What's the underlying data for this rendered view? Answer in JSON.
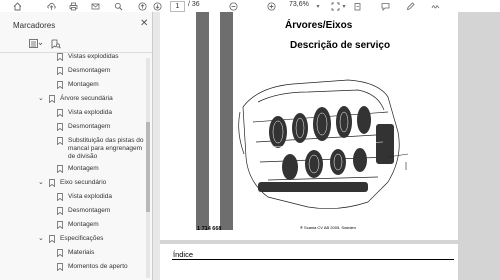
{
  "toolbar": {
    "current_page": "1",
    "total_pages": "/ 36",
    "zoom": "73,6%",
    "icons": [
      "home-icon",
      "upload-icon",
      "print-icon",
      "mail-icon",
      "search-icon",
      "up-arrow-icon",
      "down-arrow-icon",
      "zoom-out-icon",
      "zoom-in-icon",
      "chevron-down-icon",
      "cursor-icon",
      "hand-icon",
      "fit-page-icon",
      "chevron-down-icon",
      "rotate-icon",
      "comment-icon",
      "pen-icon",
      "sign-icon"
    ]
  },
  "sidebar": {
    "title": "Marcadores",
    "items": [
      {
        "label": "Vistas explodidas",
        "level": 2
      },
      {
        "label": "Desmontagem",
        "level": 2
      },
      {
        "label": "Montagem",
        "level": 2
      },
      {
        "label": "Árvore secundária",
        "level": 1,
        "expanded": true
      },
      {
        "label": "Vista explodida",
        "level": 2
      },
      {
        "label": "Desmontagem",
        "level": 2
      },
      {
        "label": "Substituição das pistas do mancal para engrenagem de divisão",
        "level": 2
      },
      {
        "label": "Montagem",
        "level": 2
      },
      {
        "label": "Eixo secundário",
        "level": 1,
        "expanded": true
      },
      {
        "label": "Vista explodida",
        "level": 2
      },
      {
        "label": "Desmontagem",
        "level": 2
      },
      {
        "label": "Montagem",
        "level": 2
      },
      {
        "label": "Especificações",
        "level": 1,
        "expanded": true
      },
      {
        "label": "Materiais",
        "level": 2
      },
      {
        "label": "Momentos de aperto",
        "level": 2
      }
    ]
  },
  "document": {
    "title": "Árvores/Eixos",
    "subtitle": "Descrição de serviço",
    "part_number": "1 714 668",
    "copyright": "® Scania CV AB 2005, Sweden",
    "next_page_heading": "Índice"
  }
}
